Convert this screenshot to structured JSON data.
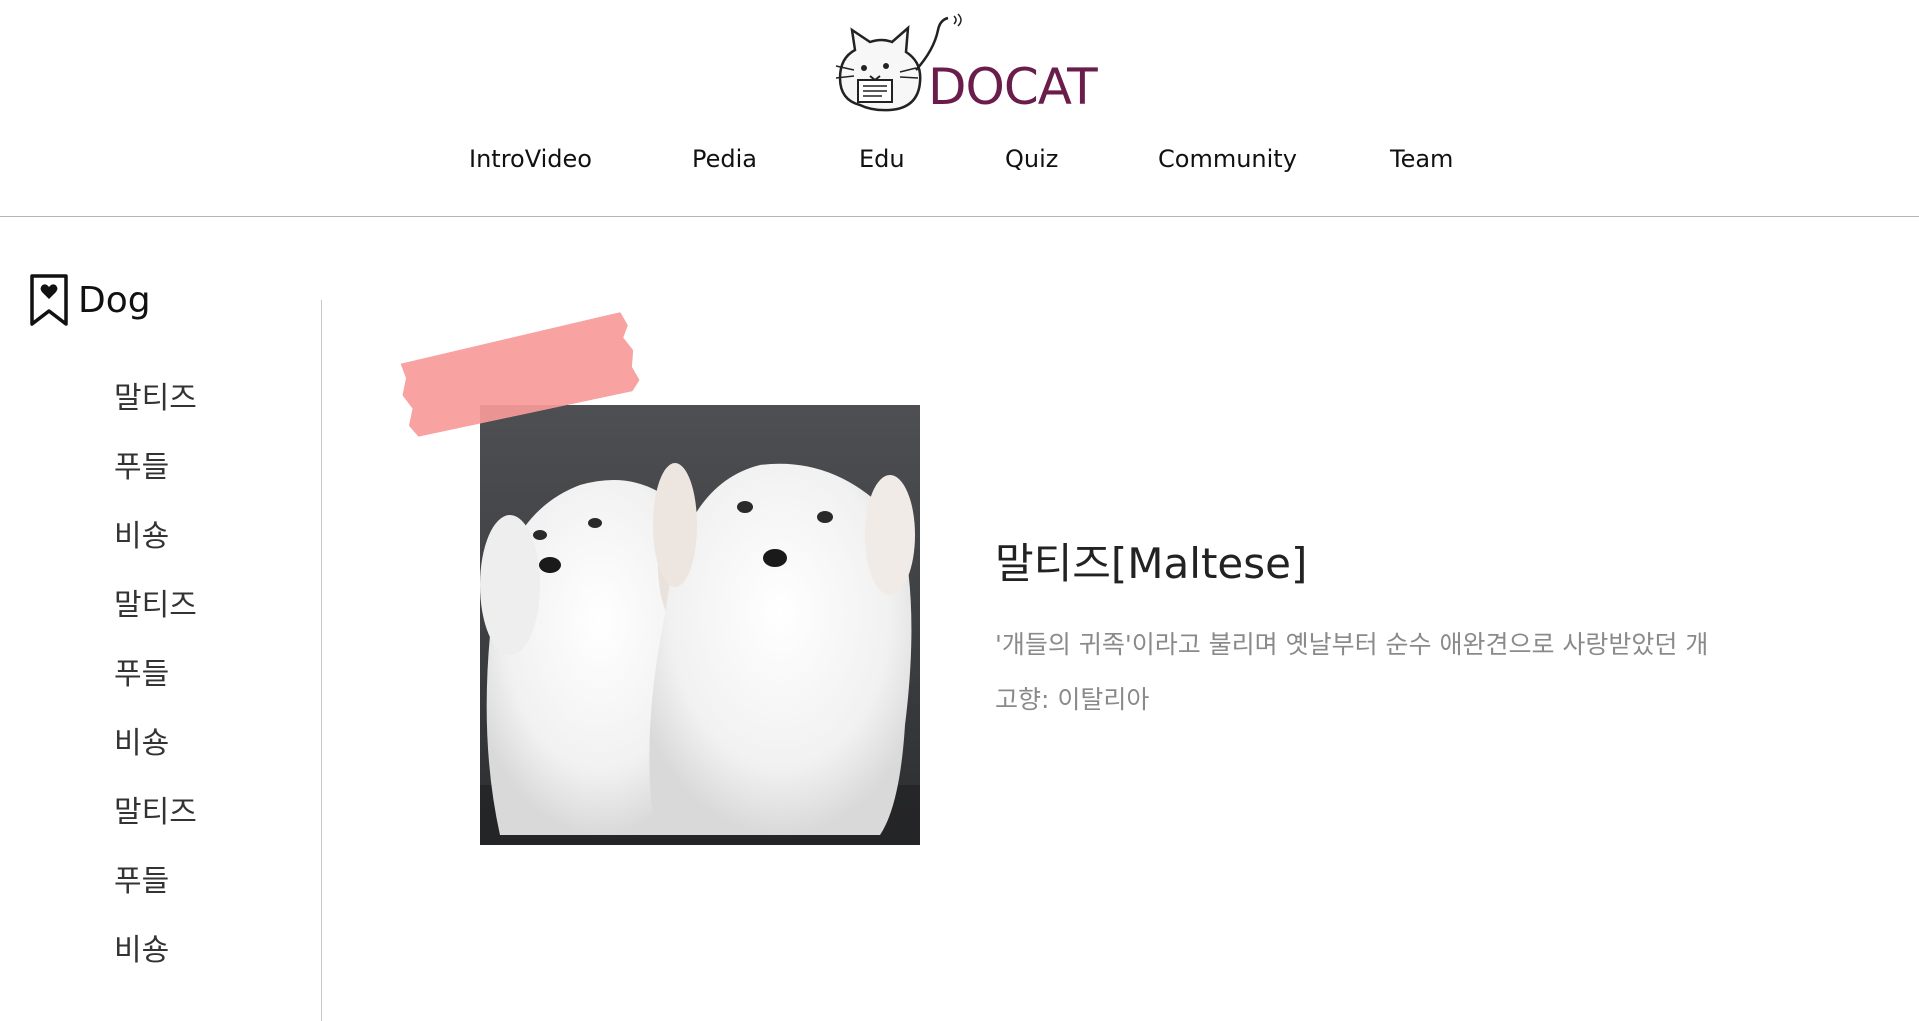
{
  "header": {
    "logo_text": "DOCAT",
    "nav": [
      "IntroVideo",
      "Pedia",
      "Edu",
      "Quiz",
      "Community",
      "Team"
    ]
  },
  "sidebar": {
    "title": "Dog",
    "items": [
      "말티즈",
      "푸들",
      "비숑",
      "말티즈",
      "푸들",
      "비숑",
      "말티즈",
      "푸들",
      "비숑"
    ]
  },
  "main": {
    "breed_name": "말티즈[Maltese]",
    "description": "'개들의 귀족'이라고 불리며 옛날부터 순수 애완견으로 사랑받았던 개",
    "origin": "고향: 이탈리아"
  },
  "colors": {
    "brand": "#6a1d4b",
    "tape": "#f79a9a",
    "muted_text": "#8a8a8a"
  },
  "icons": {
    "logo": "cat-reading-logo-icon",
    "sidebar_title": "bookmark-heart-icon"
  }
}
